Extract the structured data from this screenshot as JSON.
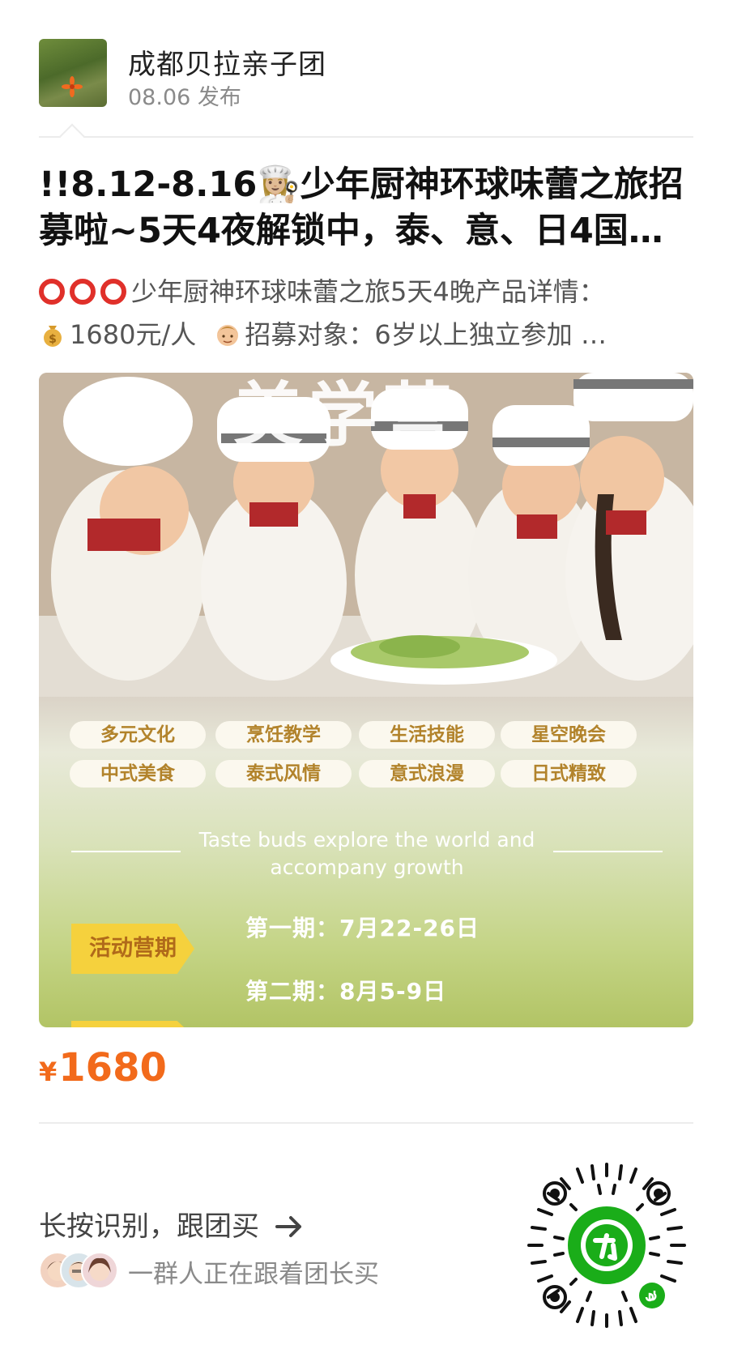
{
  "header": {
    "author": "成都贝拉亲子团",
    "date": "08.06 发布"
  },
  "post": {
    "title": "!!8.12-8.16👩🏼‍🍳少年厨神环球味蕾之旅招募啦~5天4夜解锁中，泰、意、日4国…",
    "desc_line1": "少年厨神环球味蕾之旅5天4晚产品详情：",
    "desc_line2_price": "1680元/人",
    "desc_line2_rest": "招募对象：6岁以上独立参加 …"
  },
  "poster": {
    "headline": "美学营",
    "tags": [
      "多元文化",
      "烹饪教学",
      "生活技能",
      "星空晚会",
      "中式美食",
      "泰式风情",
      "意式浪漫",
      "日式精致"
    ],
    "tagline_1": "Taste buds explore the world and",
    "tagline_2": "accompany growth",
    "badge": "活动营期",
    "period_1": "第一期：7月22-26日",
    "period_2": "第二期：8月5-9日"
  },
  "price": {
    "currency": "¥",
    "value": "1680"
  },
  "footer": {
    "cta": "长按识别，跟团买",
    "followers": "一群人正在跟着团长买"
  },
  "colors": {
    "price": "#f26a1b",
    "qr_green": "#1aad19",
    "badge": "#f5d13d"
  },
  "icons": {
    "arrow": "arrow-right-icon",
    "miniprogram": "mini-program-icon"
  }
}
